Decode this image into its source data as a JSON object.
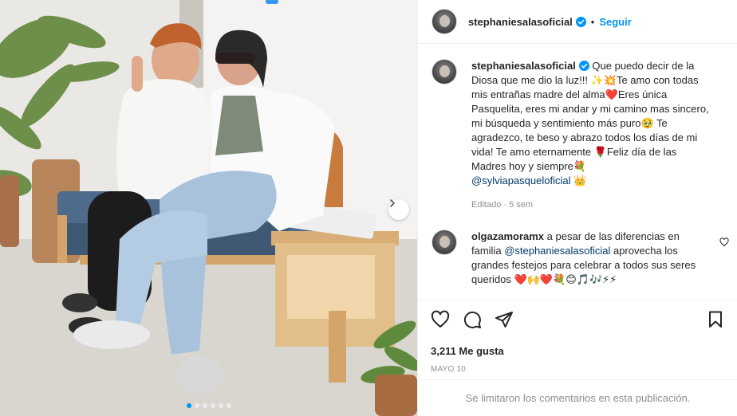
{
  "post": {
    "username": "stephaniesalasoficial",
    "separator": "•",
    "follow_label": "Seguir",
    "accent_color": "#0095f6",
    "caption": {
      "username": "stephaniesalasoficial",
      "text": "Que puedo decir de la Diosa que me dio la luz!!! ✨💥Te amo con todas mis entrañas madre del alma❤️Eres única Pasquelita, eres mi andar y mi camino mas sincero, mi búsqueda y sentimiento más puro🥹 Te agradezco, te beso y abrazo todos los días de mi vida! Te amo eternamente 🌹Feliz día de las Madres hoy y siempre💐",
      "mention": "@sylviapasqueloficial",
      "mention_tail": " 👑",
      "meta": "Editado · 5 sem"
    },
    "comment": {
      "username": "olgazamoramx",
      "text_before": " a pesar de las diferencias en familia ",
      "mention": "@stephaniesalasoficial",
      "text_after": " aprovecha los grandes festejos para celebrar a todos sus seres queridos ❤️🙌❤️💐😊🎵🎶⚡⚡"
    },
    "likes": "3,211 Me gusta",
    "date": "MAYO 10",
    "comments_limited": "Se limitaron los comentarios en esta publicación.",
    "carousel": {
      "dots": 6,
      "active_index": 0
    },
    "icons": [
      "heart-icon",
      "comment-icon",
      "share-icon",
      "bookmark-icon",
      "verified-badge-icon",
      "chevron-right-icon"
    ]
  }
}
